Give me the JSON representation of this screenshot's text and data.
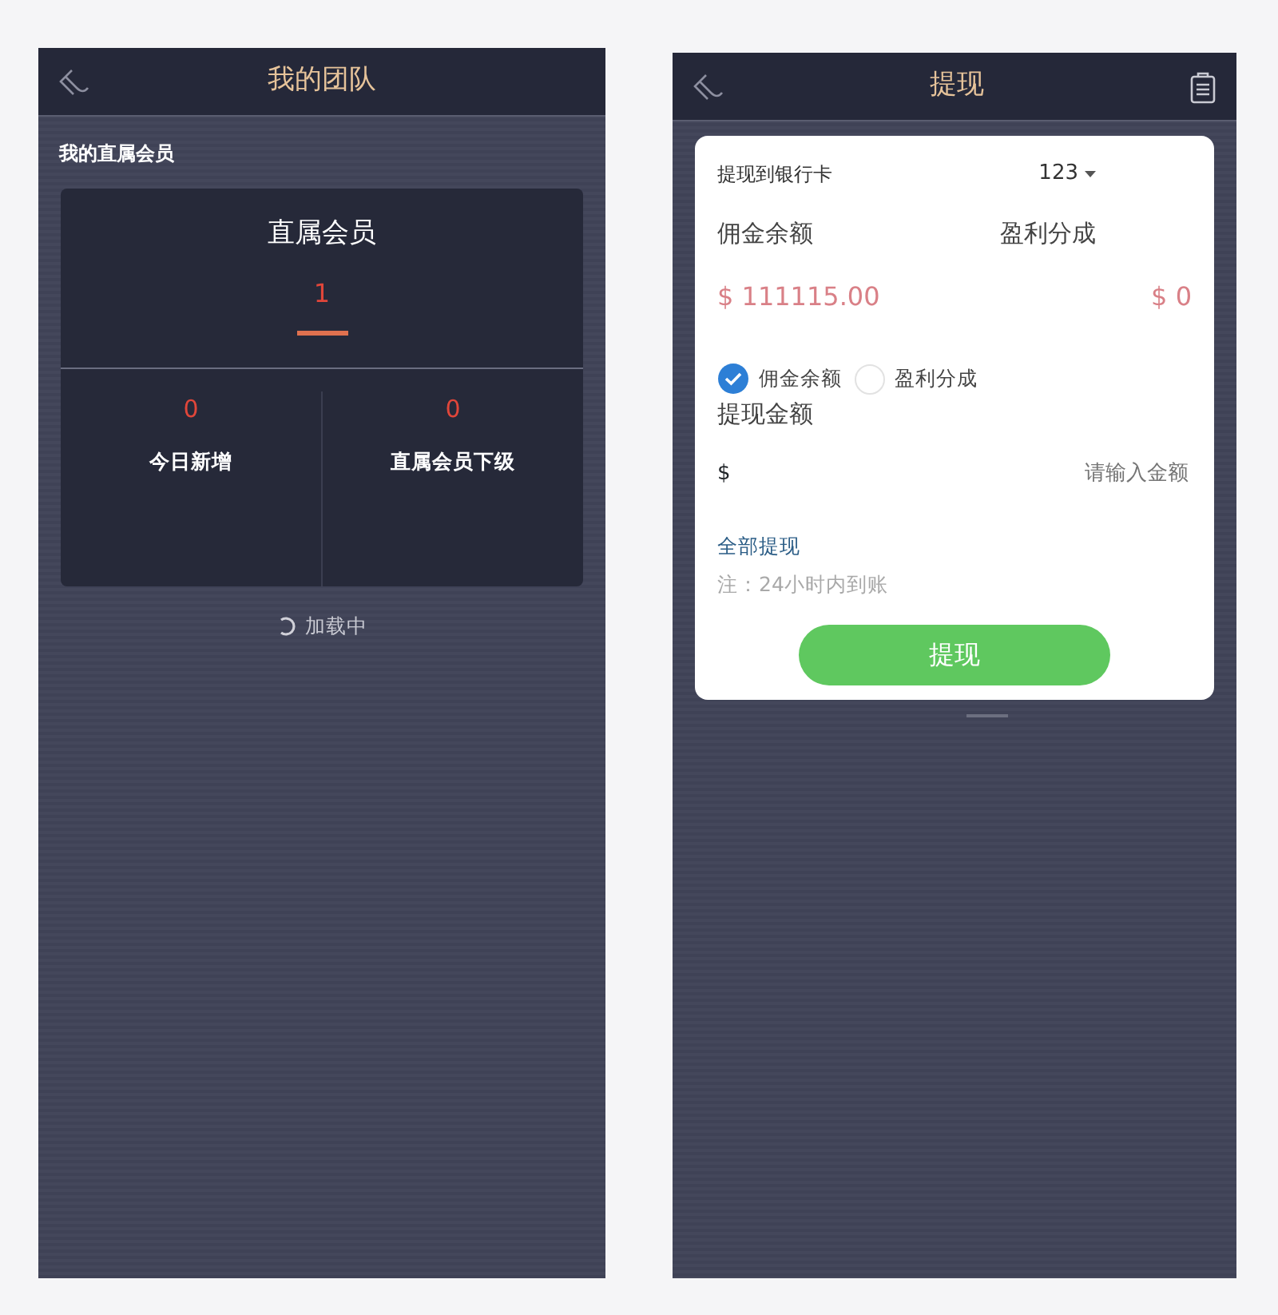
{
  "team_screen": {
    "header": {
      "title": "我的团队"
    },
    "section_label": "我的直属会员",
    "card": {
      "title": "直属会员",
      "count": "1",
      "stats": [
        {
          "value": "0",
          "label": "今日新增"
        },
        {
          "value": "0",
          "label": "直属会员下级"
        }
      ]
    },
    "loading": "加载中"
  },
  "withdraw_screen": {
    "header": {
      "title": "提现"
    },
    "bank_label": "提现到银行卡",
    "bank_value": "123",
    "balances": [
      {
        "label": "佣金余额",
        "amount": "$ 111115.00"
      },
      {
        "label": "盈利分成",
        "amount": "$ 0"
      }
    ],
    "sources": [
      {
        "label": "佣金余额",
        "selected": true
      },
      {
        "label": "盈利分成",
        "selected": false
      }
    ],
    "amount_label": "提现金额",
    "currency": "$",
    "amount_placeholder": "请输入金额",
    "withdraw_all": "全部提现",
    "note": "注：24小时内到账",
    "submit": "提现"
  }
}
